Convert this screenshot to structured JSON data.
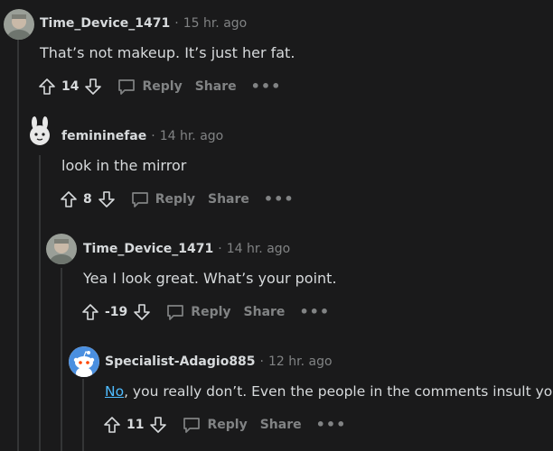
{
  "comments": [
    {
      "author": "Time_Device_1471",
      "time": "15 hr. ago",
      "text": "That’s not makeup. It’s just her fat.",
      "score": "14",
      "reply_label": "Reply",
      "share_label": "Share",
      "avatar_icon": "user-photo-avatar"
    },
    {
      "author": "femininefae",
      "time": "14 hr. ago",
      "text": "look in the mirror",
      "score": "8",
      "reply_label": "Reply",
      "share_label": "Share",
      "avatar_icon": "bunny-avatar"
    },
    {
      "author": "Time_Device_1471",
      "time": "14 hr. ago",
      "text": "Yea I look great. What’s your point.",
      "score": "-19",
      "reply_label": "Reply",
      "share_label": "Share",
      "avatar_icon": "user-photo-avatar"
    },
    {
      "author": "Specialist-Adagio885",
      "time": "12 hr. ago",
      "text_link": "No",
      "text_rest": ", you really don’t. Even the people in the comments insult you",
      "score": "11",
      "reply_label": "Reply",
      "share_label": "Share",
      "avatar_icon": "snoo-avatar"
    }
  ],
  "separator": "·",
  "more_label": "•••",
  "colors": {
    "background": "#1a1a1b",
    "text": "#d7dadc",
    "muted": "#818384",
    "link": "#4fbcff",
    "thread_line": "#343536",
    "snoo_blue": "#4a8fe0"
  }
}
